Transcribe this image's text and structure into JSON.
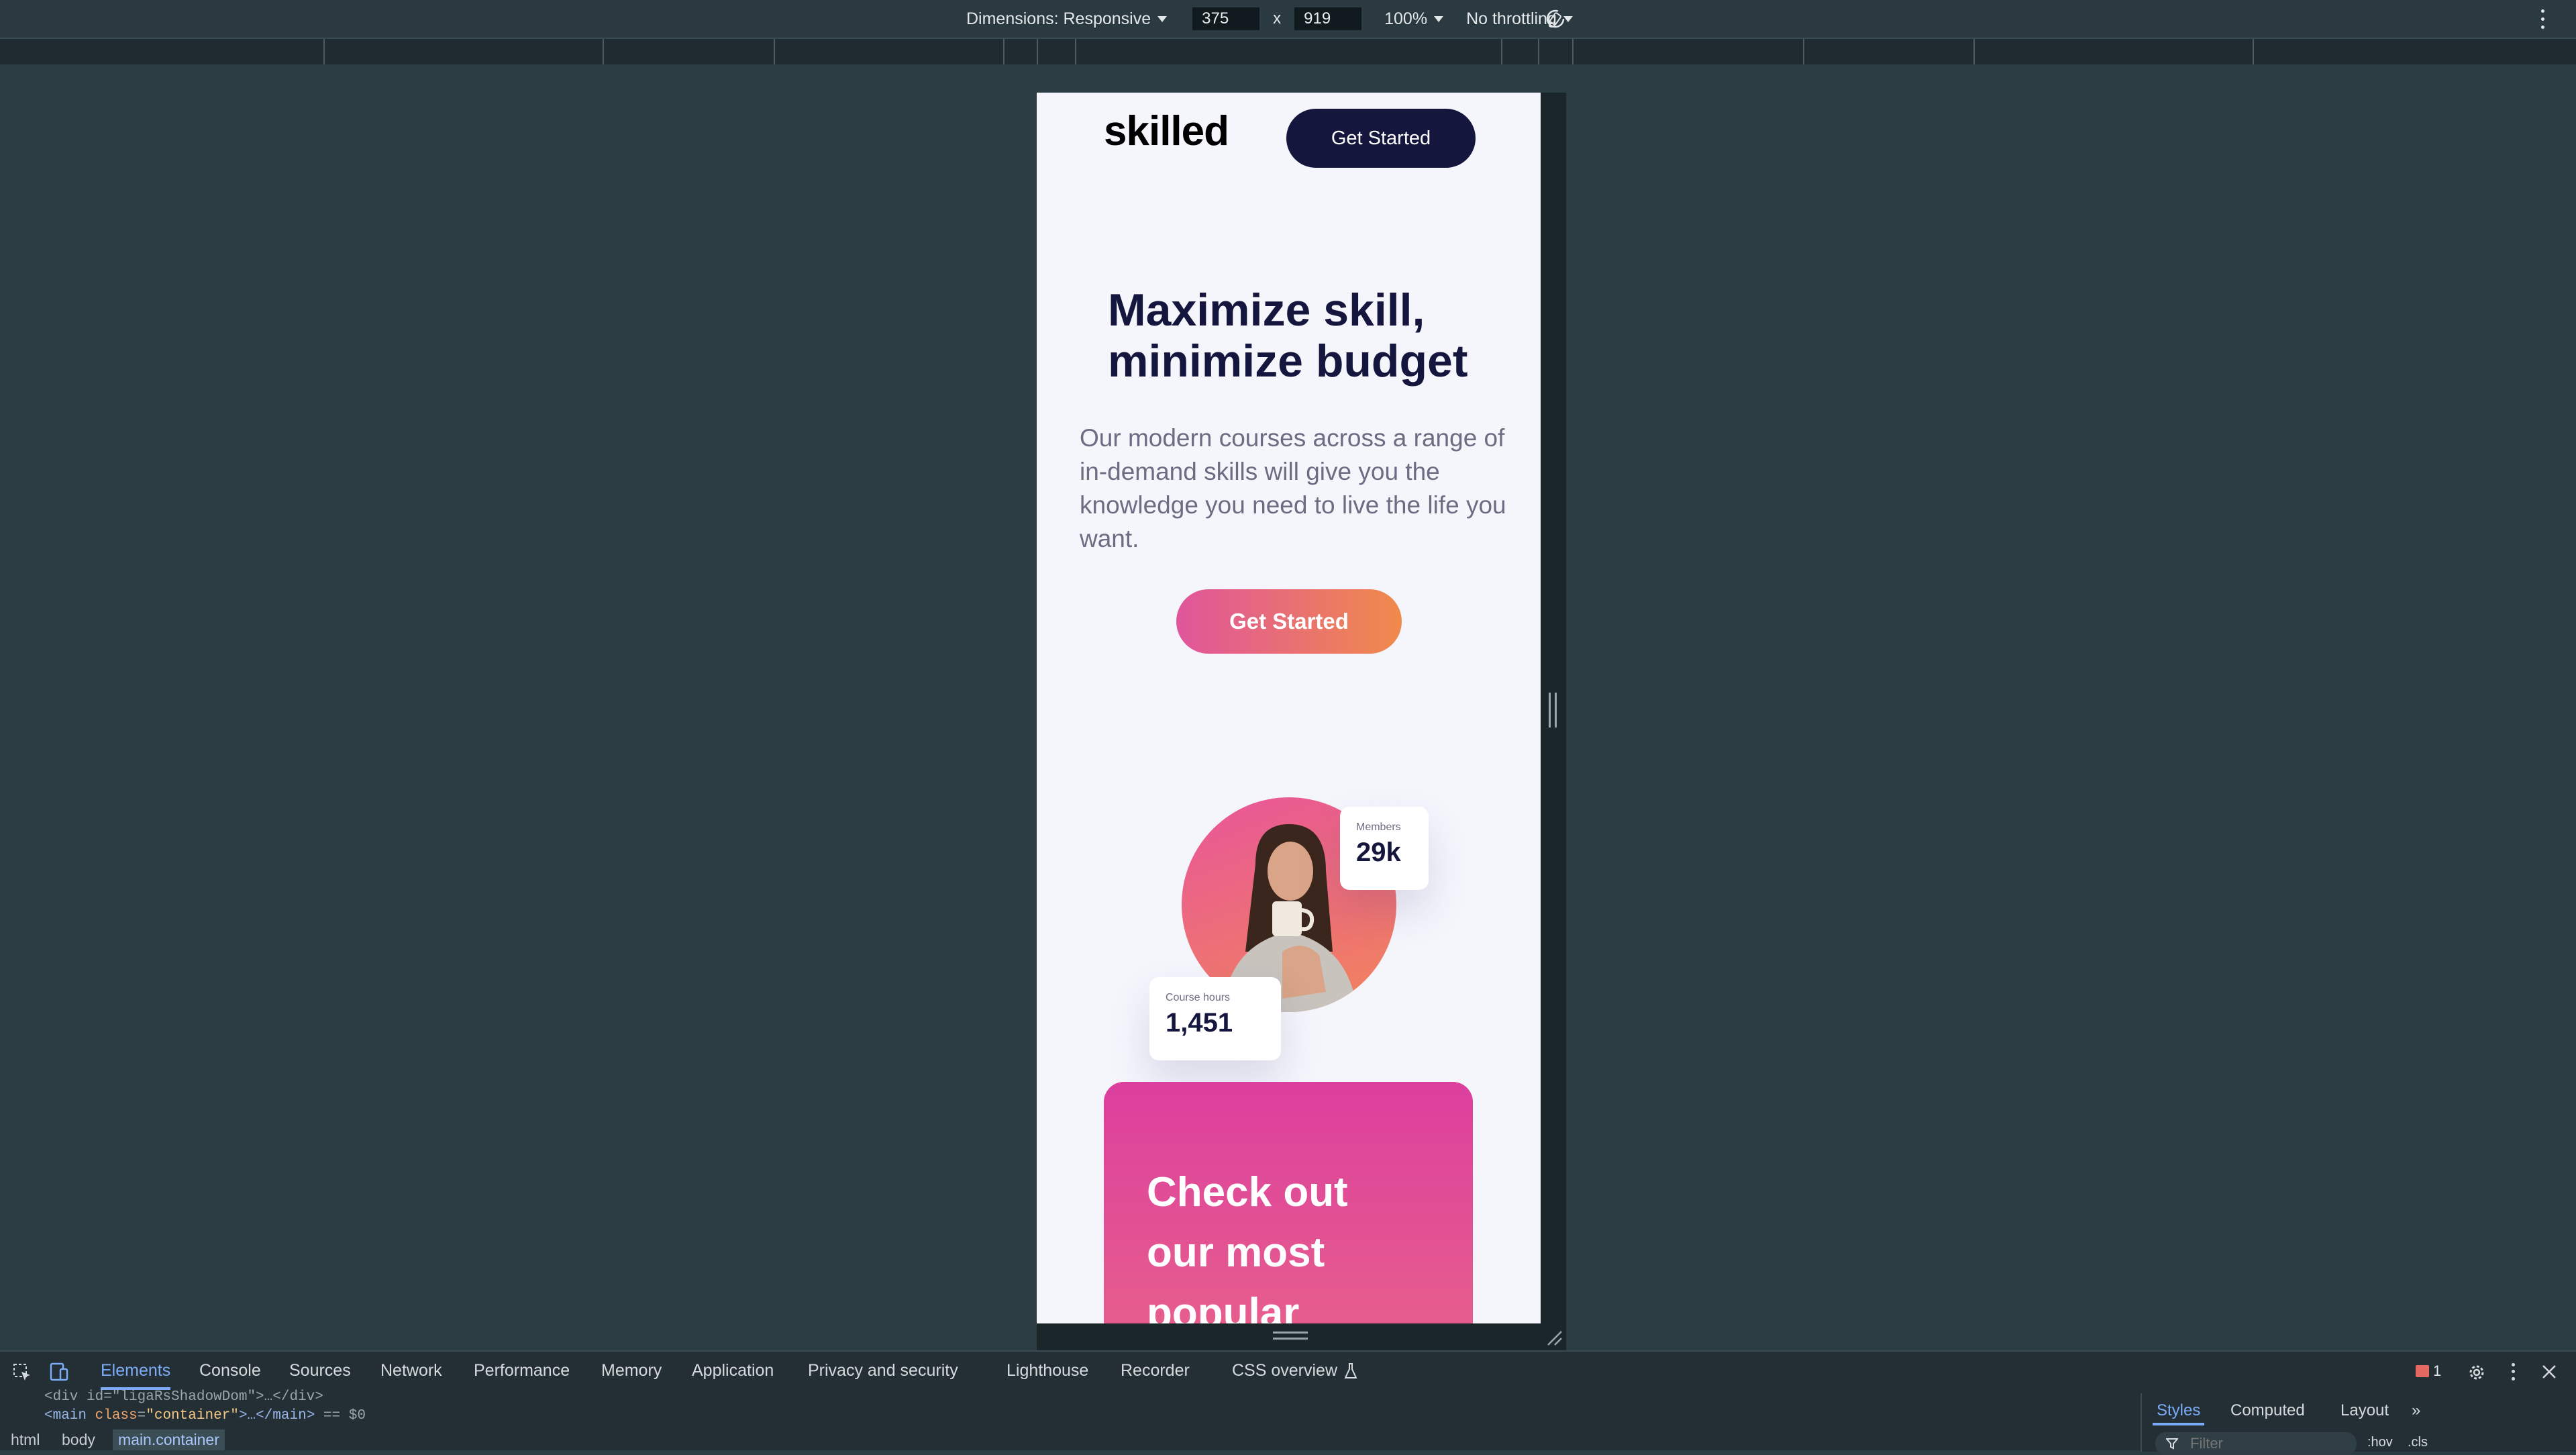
{
  "device_toolbar": {
    "dimensions_label": "Dimensions: Responsive",
    "width_value": "375",
    "times": "x",
    "height_value": "919",
    "zoom": "100%",
    "throttling": "No throttling"
  },
  "page": {
    "logo": "skilled",
    "nav_cta": "Get Started",
    "hero_title": "Maximize skill, minimize budget",
    "hero_text": "Our modern courses across a range of in-demand skills will give you the knowledge you need to live the life you want.",
    "hero_cta": "Get Started",
    "stats": {
      "members_label": "Members",
      "members_value": "29k",
      "hours_label": "Course hours",
      "hours_value": "1,451"
    },
    "promo_title": "Check out our most popular"
  },
  "devtools": {
    "tabs": [
      "Elements",
      "Console",
      "Sources",
      "Network",
      "Performance",
      "Memory",
      "Application",
      "Privacy and security",
      "Lighthouse",
      "Recorder",
      "CSS overview"
    ],
    "issues_count": "1",
    "dom_line1": "<div id=\"ligaRsShadowDom\">…</div>",
    "dom_line2": {
      "tag_open": "<main ",
      "attr_name": "class",
      "attr_value": "\"container\"",
      "tag_close": ">…</main>",
      "suffix": "== $0"
    },
    "breadcrumbs": [
      "html",
      "body",
      "main.container"
    ],
    "styles_tabs": [
      "Styles",
      "Computed",
      "Layout"
    ],
    "filter_placeholder": "Filter",
    "hov": ":hov",
    "cls": ".cls"
  },
  "colors": {
    "navy": "#15163d",
    "accent_gradient_start": "#e0559c",
    "accent_gradient_end": "#f08a4b",
    "page_bg": "#f5f5fc",
    "devtools_bg": "#2b3c42"
  }
}
